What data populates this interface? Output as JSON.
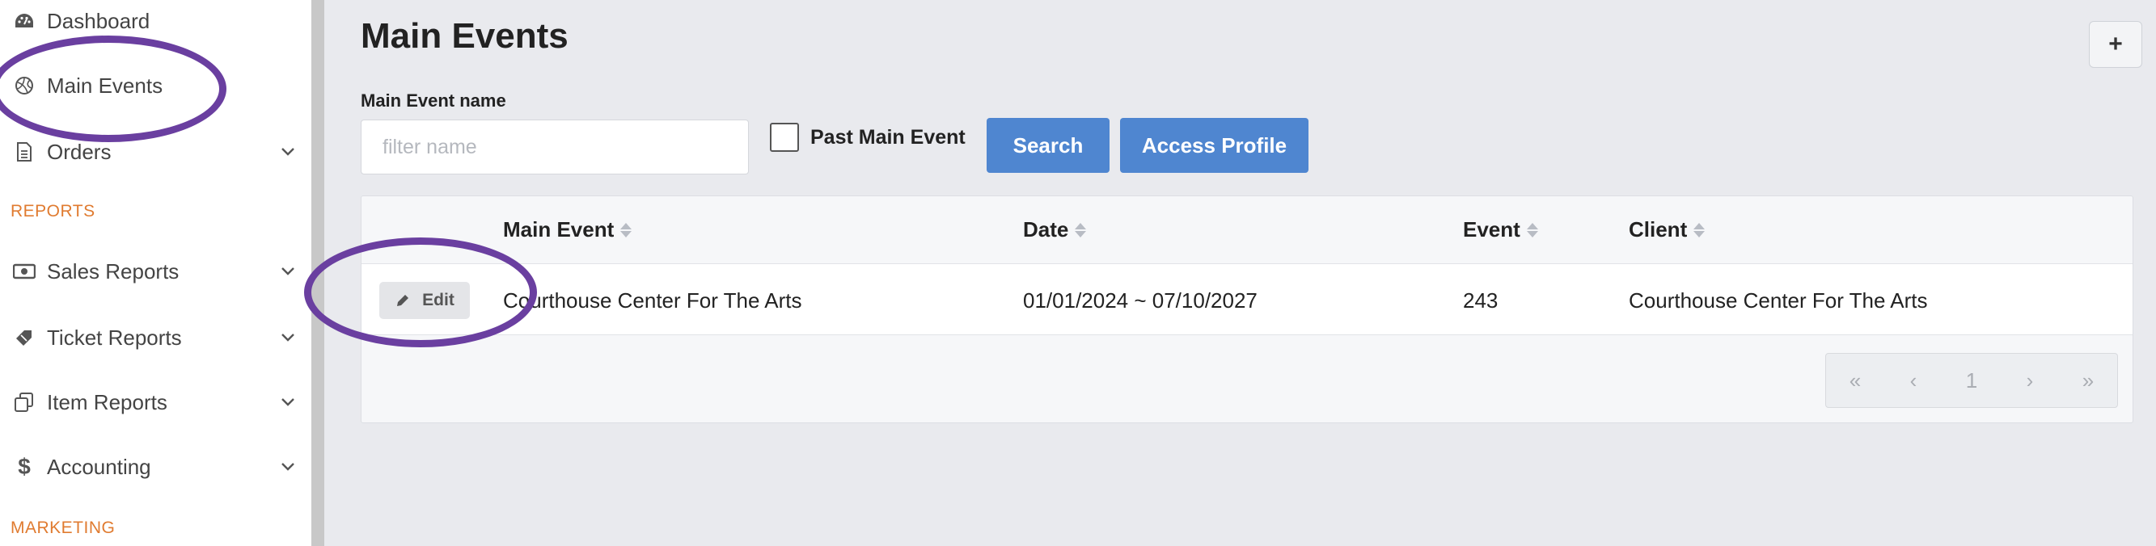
{
  "sidebar": {
    "items": [
      {
        "label": "Dashboard",
        "icon": "dashboard-gauge-icon"
      },
      {
        "label": "Main Events",
        "icon": "main-events-icon"
      },
      {
        "label": "Orders",
        "icon": "document-icon",
        "expandable": true
      },
      {
        "label": "Sales Reports",
        "icon": "money-icon",
        "expandable": true
      },
      {
        "label": "Ticket Reports",
        "icon": "ticket-icon",
        "expandable": true
      },
      {
        "label": "Item Reports",
        "icon": "copy-icon",
        "expandable": true
      },
      {
        "label": "Accounting",
        "icon": "dollar-icon",
        "expandable": true
      }
    ],
    "sections": {
      "reports": "REPORTS",
      "marketing": "MARKETING"
    }
  },
  "main": {
    "title": "Main Events",
    "add_button": "+",
    "filter": {
      "label": "Main Event name",
      "placeholder": "filter name",
      "value": ""
    },
    "past_checkbox": {
      "label": "Past Main Event",
      "checked": false
    },
    "buttons": {
      "search": "Search",
      "access_profile": "Access Profile"
    },
    "table": {
      "columns": [
        "Main Event",
        "Date",
        "Event",
        "Client"
      ],
      "rows": [
        {
          "action": "Edit",
          "main_event": "Courthouse Center For The Arts",
          "date": "01/01/2024 ~ 07/10/2027",
          "event": "243",
          "client": "Courthouse Center For The Arts"
        }
      ]
    },
    "pagination": {
      "first": "«",
      "prev": "‹",
      "page": "1",
      "next": "›",
      "last": "»"
    }
  },
  "colors": {
    "accent": "#4f86d0",
    "section_label": "#e07b30",
    "annotation": "#6a3fa0"
  }
}
